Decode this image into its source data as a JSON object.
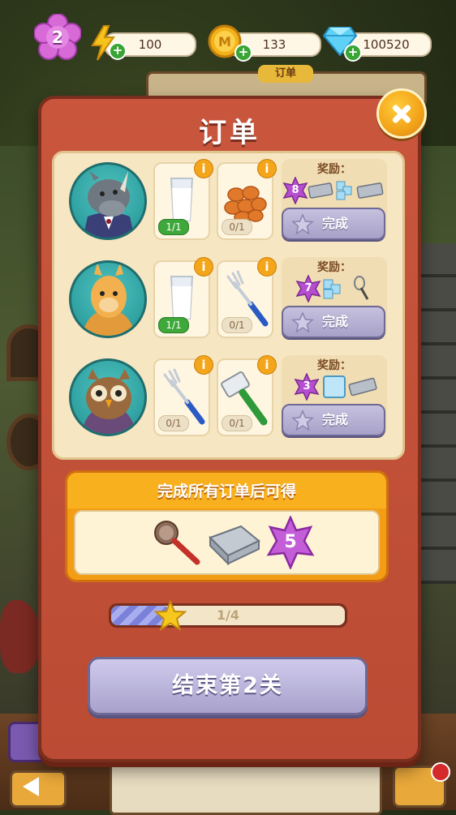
{
  "hud": {
    "level": "2",
    "energy": "100",
    "coins": "133",
    "gems": "100520"
  },
  "background": {
    "order_tab": "订单"
  },
  "modal": {
    "title": "订单",
    "orders": [
      {
        "character": "rhino",
        "items": [
          {
            "icon": "milk-glass-icon",
            "count": "1/1",
            "done": true
          },
          {
            "icon": "fried-nuggets-icon",
            "count": "0/1",
            "done": false
          }
        ],
        "reward_label": "奖励：",
        "reward_stars": "8",
        "rewards": [
          "silverware-tray-icon",
          "ice-cubes-icon",
          "silverware-tray-icon"
        ],
        "complete_label": "完成"
      },
      {
        "character": "alpaca",
        "items": [
          {
            "icon": "milk-glass-icon",
            "count": "1/1",
            "done": true
          },
          {
            "icon": "fork-icon",
            "count": "0/1",
            "done": false
          }
        ],
        "reward_label": "奖励：",
        "reward_stars": "7",
        "rewards": [
          "ice-cubes-icon",
          "whisk-icon"
        ],
        "complete_label": "完成"
      },
      {
        "character": "owl",
        "items": [
          {
            "icon": "fork-icon",
            "count": "0/1",
            "done": false
          },
          {
            "icon": "meat-tenderizer-icon",
            "count": "0/1",
            "done": false
          }
        ],
        "reward_label": "奖励：",
        "reward_stars": "3",
        "rewards": [
          "ice-block-icon",
          "silverware-tray-icon"
        ],
        "complete_label": "完成"
      }
    ],
    "bonus_title": "完成所有订单后可得",
    "bonus_rewards": [
      "strainer-icon",
      "silverware-tray-icon"
    ],
    "bonus_stars": "5",
    "progress_text": "1/4",
    "progress_fraction": 0.25,
    "end_button": "结束第2关"
  },
  "colors": {
    "modal_bg": "#c9563c",
    "panel_bg": "#f7e6c2",
    "button_purple": "#a7a1c8",
    "done_green": "#3ea83a",
    "accent_orange": "#f39d14"
  }
}
